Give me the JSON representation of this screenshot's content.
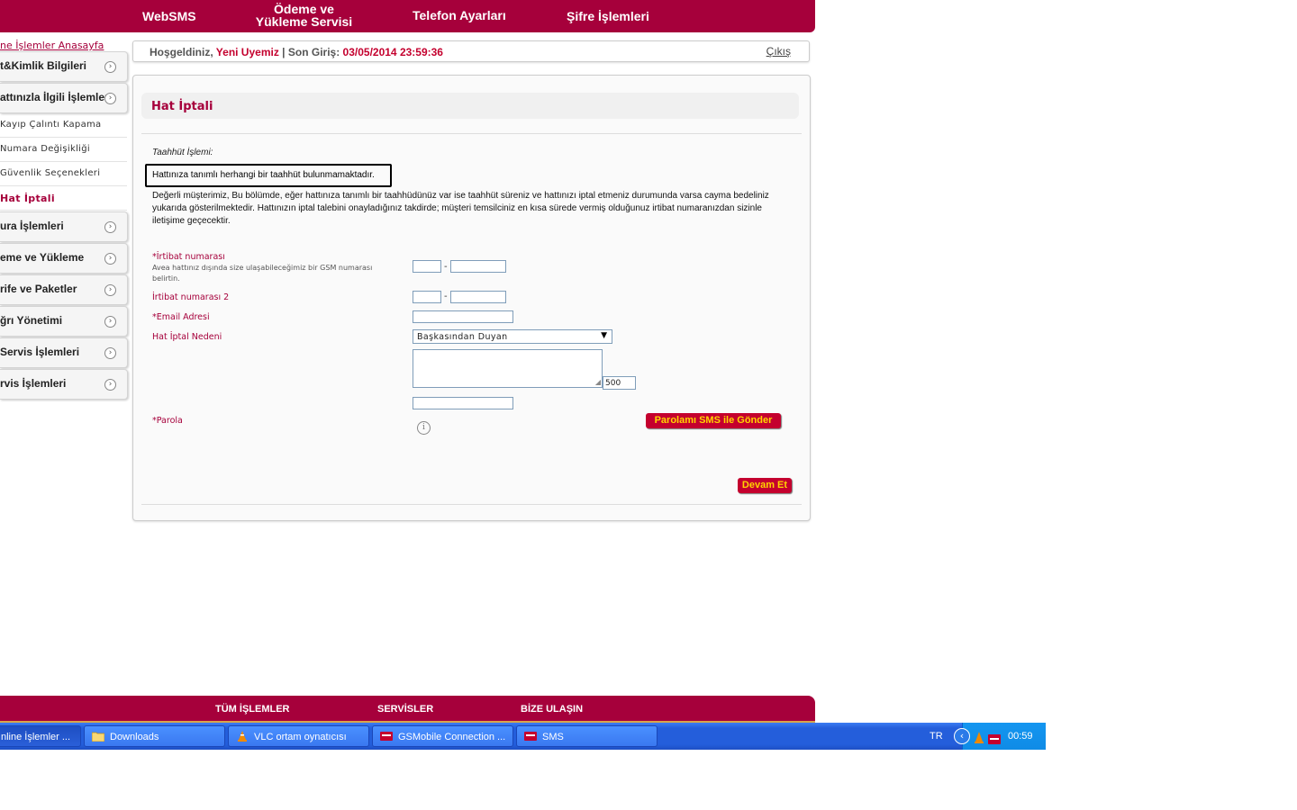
{
  "top_nav": {
    "websms": "WebSMS",
    "odeme_line1": "Ödeme ve",
    "odeme_line2": "Yükleme Servisi",
    "telefon": "Telefon Ayarları",
    "sifre": "Şifre İşlemleri"
  },
  "sidebar": {
    "breadcrumb": "ne İşlemler Anasayfa",
    "items": [
      {
        "label": "t&Kimlik Bilgileri",
        "kind": "big"
      },
      {
        "label": "attınızla İlgili İşlemler",
        "kind": "big"
      },
      {
        "label": "Kayıp Çalıntı Kapama",
        "kind": "small"
      },
      {
        "label": "Numara Değişikliği",
        "kind": "small"
      },
      {
        "label": "Güvenlik Seçenekleri",
        "kind": "small"
      },
      {
        "label": "Hat İptali",
        "kind": "small-active"
      },
      {
        "label": "ura İşlemleri",
        "kind": "big"
      },
      {
        "label": "eme ve Yükleme",
        "kind": "big"
      },
      {
        "label": "rife ve Paketler",
        "kind": "big"
      },
      {
        "label": "ğrı Yönetimi",
        "kind": "big"
      },
      {
        "label": "Servis İşlemleri",
        "kind": "big"
      },
      {
        "label": "rvis İşlemleri",
        "kind": "big"
      }
    ]
  },
  "welcome": {
    "greeting": "Hoşgeldiniz,",
    "user": "Yeni Uyemiz",
    "sep": "| Son Giriş:",
    "last_login": "03/05/2014 23:59:36",
    "logout": "Çıkış"
  },
  "page": {
    "title": "Hat İptali",
    "taahhut_label": "Taahhüt İşlemi:",
    "taahhut_text": "Hattınıza tanımlı herhangi bir taahhüt bulunmamaktadır.",
    "info_text": "Değerli müşterimiz, Bu bölümde, eğer hattınıza tanımlı bir taahhüdünüz var ise taahhüt süreniz ve hattınızı iptal etmeniz durumunda varsa cayma bedeliniz yukarıda gösterilmektedir. Hattınızın iptal talebini onayladığınız takdirde; müşteri temsilciniz en kısa sürede vermiş olduğunuz irtibat numaranızdan sizinle iletişime geçecektir."
  },
  "form": {
    "irtibat1_label": "*İrtibat numarası",
    "irtibat1_hint": "Avea hattınız dışında size ulaşabileceğimiz bir GSM numarası belirtin.",
    "irtibat2_label": "İrtibat numarası 2",
    "email_label": "*Email Adresi",
    "reason_label": "Hat İptal Nedeni",
    "reason_value": "Başkasından Duyan",
    "counter": "500",
    "parola_label": "*Parola",
    "sms_button": "Parolamı SMS ile Gönder",
    "continue_button": "Devam Et",
    "dash": "-"
  },
  "footer": {
    "all": "TÜM İŞLEMLER",
    "services": "SERVİSLER",
    "contact": "BİZE ULAŞIN"
  },
  "taskbar": {
    "tasks": [
      "nline İşlemler ...",
      "Downloads",
      "VLC ortam oynatıcısı",
      "GSMobile Connection ...",
      "SMS"
    ],
    "lang": "TR",
    "clock": "00:59"
  }
}
